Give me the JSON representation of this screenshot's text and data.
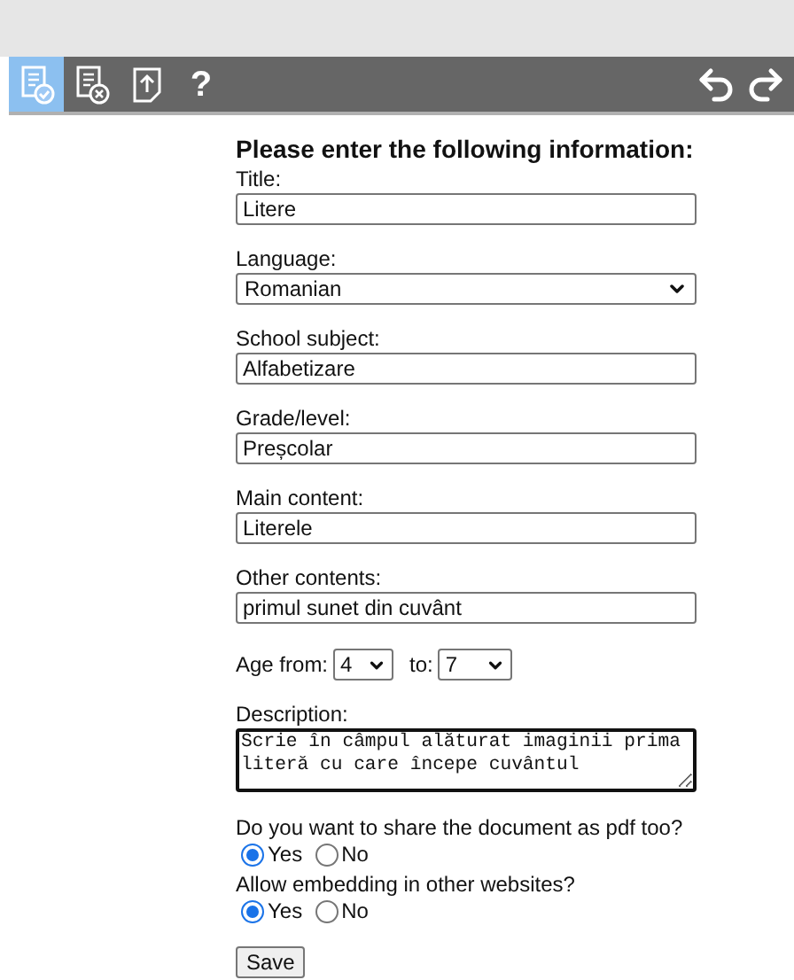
{
  "toolbar": {
    "tools": [
      {
        "kind": "accept",
        "selected": true
      },
      {
        "kind": "discard",
        "selected": false
      },
      {
        "kind": "upload",
        "selected": false
      },
      {
        "kind": "help",
        "label": "?",
        "selected": false
      }
    ],
    "history": [
      {
        "kind": "undo"
      },
      {
        "kind": "redo"
      }
    ]
  },
  "form": {
    "heading": "Please enter the following information:",
    "fields": [
      {
        "kind": "text",
        "label": "Title:",
        "value": "Litere"
      },
      {
        "kind": "select",
        "label": "Language:",
        "value": "Romanian"
      },
      {
        "kind": "text",
        "label": "School subject:",
        "value": "Alfabetizare"
      },
      {
        "kind": "text",
        "label": "Grade/level:",
        "value": "Preșcolar"
      },
      {
        "kind": "text",
        "label": "Main content:",
        "value": "Literele"
      },
      {
        "kind": "text",
        "label": "Other contents:",
        "value": "primul sunet din cuvânt"
      }
    ],
    "age": {
      "from_label": "Age from:",
      "from_value": "4",
      "to_label": "to:",
      "to_value": "7"
    },
    "description": {
      "label": "Description:",
      "value": "Scrie în câmpul alăturat imaginii prima literă cu care începe cuvântul"
    },
    "questions": [
      {
        "label": "Do you want to share the document as pdf too?",
        "options": [
          {
            "label": "Yes",
            "selected": true
          },
          {
            "label": "No",
            "selected": false
          }
        ]
      },
      {
        "label": "Allow embedding in other websites?",
        "options": [
          {
            "label": "Yes",
            "selected": true
          },
          {
            "label": "No",
            "selected": false
          }
        ]
      }
    ],
    "save_button": "Save"
  }
}
